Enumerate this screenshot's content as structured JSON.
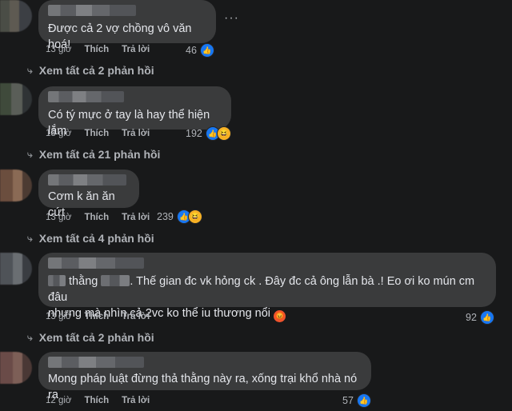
{
  "comments": [
    {
      "text": "Được cả 2 vợ chồng vô văn hoá!",
      "time": "13 giờ",
      "like_label": "Thích",
      "reply_label": "Trả lời",
      "reaction_count": "46",
      "reactions": [
        "like"
      ]
    },
    {
      "text": "Có tý mực ở tay là hay thể hiện lắm",
      "time": "13 giờ",
      "like_label": "Thích",
      "reply_label": "Trả lời",
      "reaction_count": "192",
      "reactions": [
        "like",
        "haha"
      ]
    },
    {
      "text": "Cơm k ăn ăn cứt",
      "time": "13 giờ",
      "like_label": "Thích",
      "reply_label": "Trả lời",
      "reaction_count": "239",
      "reactions": [
        "like",
        "haha"
      ]
    },
    {
      "text_part1": "thằng",
      "text_part2": ". Thế gian đc vk hỏng ck . Đây đc cả ông lẫn bà .! Eo ơi ko mún cm đâu",
      "text_line2": "nhưng mà nhìn cả 2vc ko thể iu thương nổi",
      "emoji": "angry-face",
      "time": "13 giờ",
      "like_label": "Thích",
      "reply_label": "Trả lời",
      "reaction_count": "92",
      "reactions": [
        "like"
      ]
    },
    {
      "text": "Mong pháp luật đừng thả thằng này ra, xống trại khổ nhà nó ra",
      "time": "12 giờ",
      "like_label": "Thích",
      "reply_label": "Trả lời",
      "reaction_count": "57",
      "reactions": [
        "like"
      ]
    }
  ],
  "view_replies": [
    "Xem tất cả 2 phản hồi",
    "Xem tất cả 21 phản hồi",
    "Xem tất cả 4 phản hồi",
    "Xem tất cả 2 phản hồi"
  ],
  "more_options": "···",
  "colors": {
    "background": "#18191a",
    "bubble": "#3a3b3c",
    "text": "#e4e6eb",
    "secondary_text": "#b0b3b8",
    "like_blue": "#1877f2",
    "haha_yellow": "#f7b125"
  }
}
